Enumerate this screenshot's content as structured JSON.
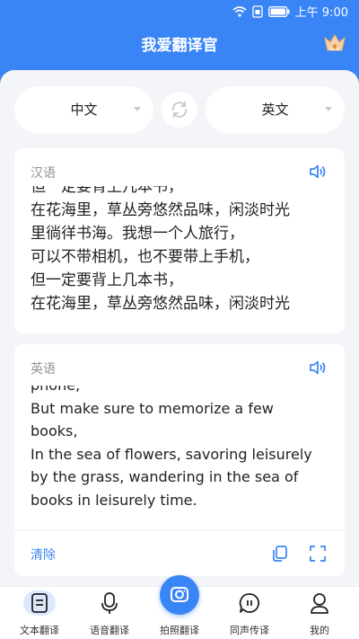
{
  "status_bar": {
    "time": "上午 9:00"
  },
  "app": {
    "title": "我爱翻译官"
  },
  "colors": {
    "primary": "#3a85f5",
    "background": "#f3f5f9"
  },
  "languages": {
    "source": "中文",
    "target": "英文"
  },
  "source_card": {
    "label": "汉语",
    "text": "但一定要背上几本书，\n在花海里，草丛旁悠然品味，闲淡时光\n里徜徉书海。我想一个人旅行，\n可以不带相机，也不要带上手机，\n但一定要背上几本书，\n在花海里，草丛旁悠然品味，闲淡时光"
  },
  "target_card": {
    "label": "英语",
    "text": "phone,\nBut make sure to memorize a few\nbooks,\nIn the sea of flowers, savoring leisurely\nby the grass, wandering in the sea of\nbooks in leisurely time.",
    "clear_label": "清除"
  },
  "tabs": [
    {
      "label": "文本翻译",
      "icon": "document-icon",
      "active": true
    },
    {
      "label": "语音翻译",
      "icon": "microphone-icon",
      "active": false
    },
    {
      "label": "拍照翻译",
      "icon": "camera-icon",
      "active": false
    },
    {
      "label": "同声传译",
      "icon": "chat-bubble-icon",
      "active": false
    },
    {
      "label": "我的",
      "icon": "user-icon",
      "active": false
    }
  ]
}
